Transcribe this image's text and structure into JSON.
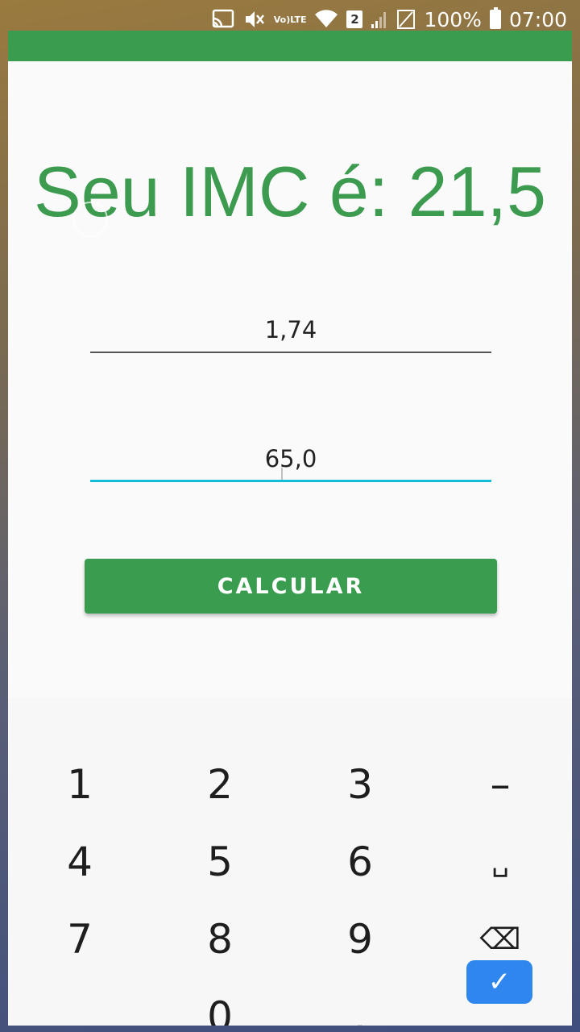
{
  "status_bar": {
    "battery": "100%",
    "time": "07:00",
    "sim_slot": "2",
    "volte_top": "Vo)",
    "volte_bottom": "LTE"
  },
  "result": {
    "text": "Seu IMC é: 21,5"
  },
  "inputs": {
    "height_value": "1,74",
    "weight_value": "65,0"
  },
  "button": {
    "label": "CALCULAR"
  },
  "keyboard": {
    "keys": [
      "1",
      "2",
      "3",
      "–",
      "4",
      "5",
      "6",
      "␣",
      "7",
      "8",
      "9",
      "⌫",
      ",",
      "0",
      ".",
      "✓"
    ]
  },
  "colors": {
    "primary": "#3a9c4f",
    "focus_underline": "#14bcd6",
    "done_key": "#2f86ef"
  }
}
